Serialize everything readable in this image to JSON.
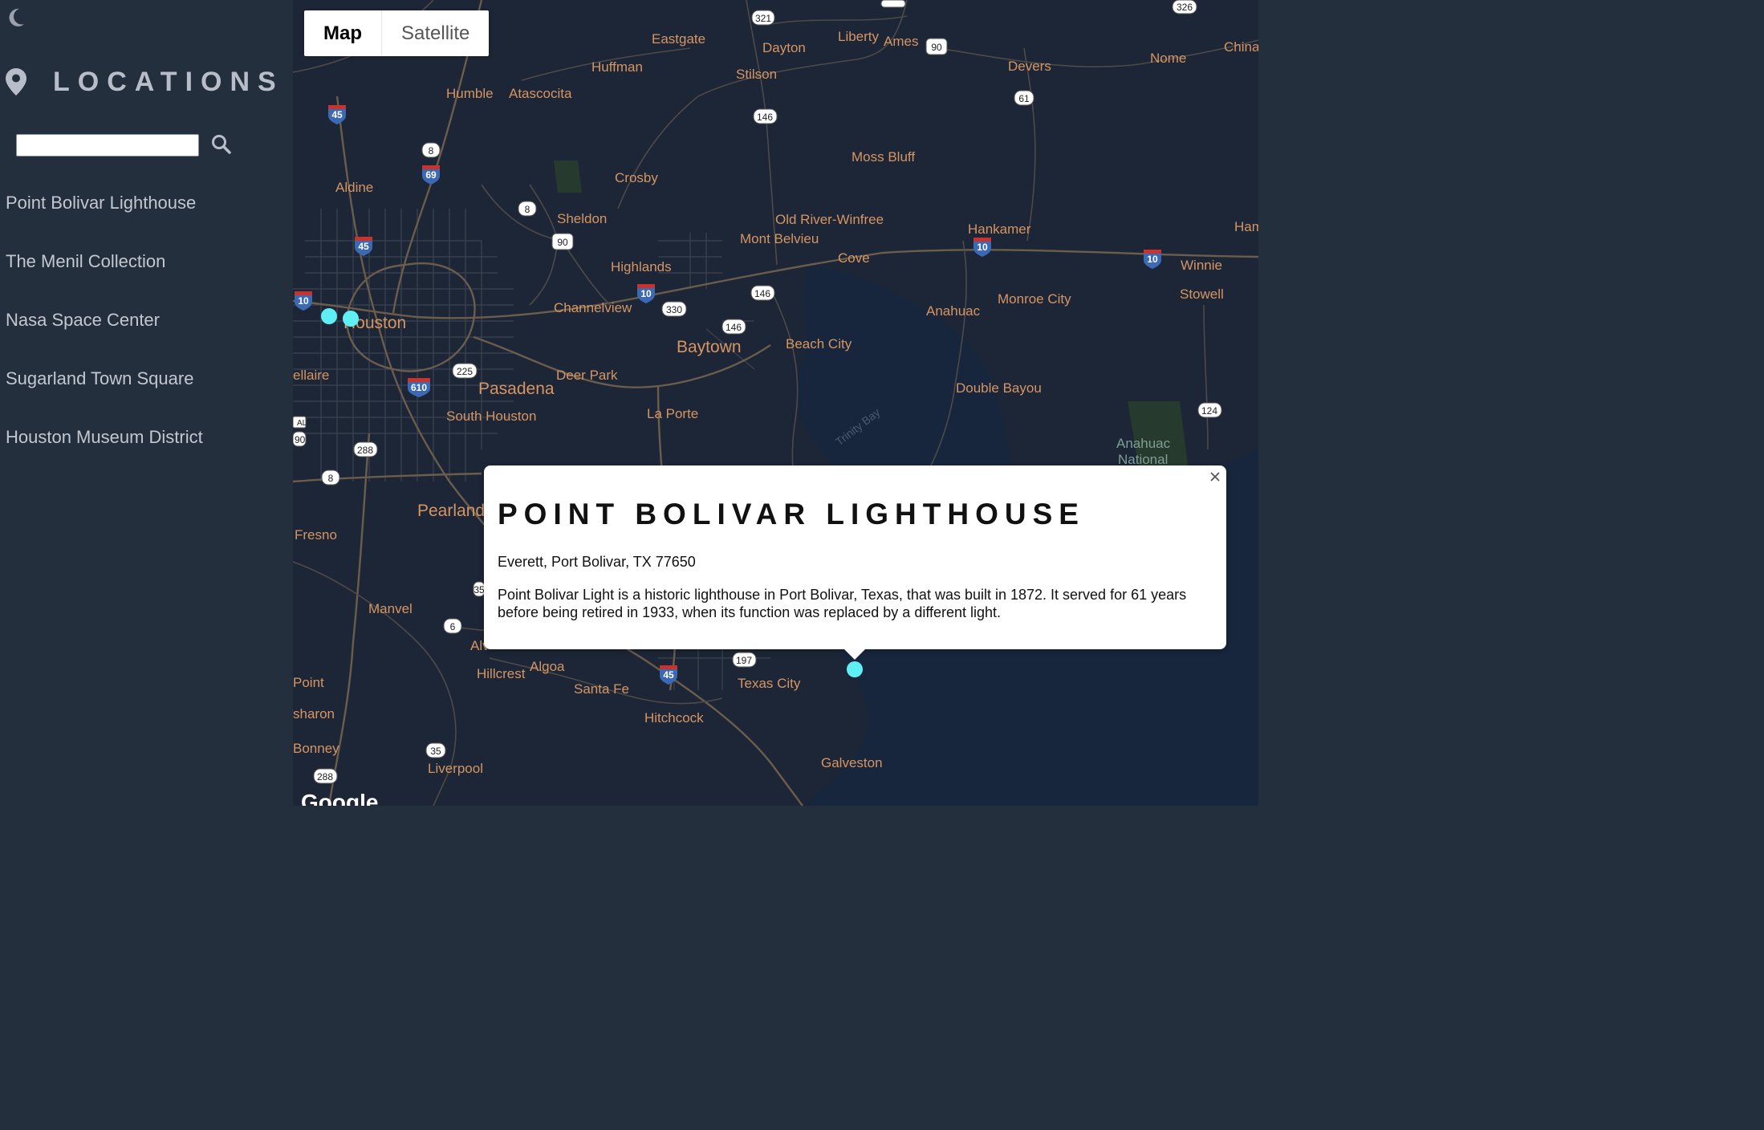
{
  "sidebar": {
    "theme_icon": "moon-icon",
    "header_icon": "map-pin-icon",
    "title": "LOCATIONS",
    "search": {
      "placeholder": "",
      "value": "",
      "button_icon": "search-icon"
    },
    "items": [
      {
        "label": "Point Bolivar Lighthouse"
      },
      {
        "label": "The Menil Collection"
      },
      {
        "label": "Nasa Space Center"
      },
      {
        "label": "Sugarland Town Square"
      },
      {
        "label": "Houston Museum District"
      }
    ]
  },
  "map": {
    "type_control": {
      "map_label": "Map",
      "satellite_label": "Satellite",
      "active": "Map"
    },
    "marker_color": "#5ef0f5",
    "places": [
      "Eastgate",
      "Dayton",
      "Liberty",
      "Ames",
      "Devers",
      "Nome",
      "China",
      "Huffman",
      "Stilson",
      "Humble",
      "Atascocita",
      "Moss Bluff",
      "Crosby",
      "Aldine",
      "Sheldon",
      "Old River-Winfree",
      "Mont Belvieu",
      "Hankamer",
      "Cove",
      "Ham",
      "Winnie",
      "Highlands",
      "Stowell",
      "Monroe City",
      "Channelview",
      "Anahuac",
      "Houston",
      "Baytown",
      "Beach City",
      "ellaire",
      "Deer Park",
      "Pasadena",
      "Double Bayou",
      "South Houston",
      "La Porte",
      "Anahuac",
      "National",
      "Pearland",
      "Fresno",
      "Manvel",
      "Alv",
      "Algoa",
      "Hillcrest",
      "Point",
      "Santa Fe",
      "Texas City",
      "sharon",
      "Hitchcock",
      "Bonney",
      "Galveston",
      "Liverpool"
    ],
    "water_labels": [
      "Trinity Bay"
    ],
    "shields": [
      "321",
      "146",
      "326",
      "90",
      "61",
      "146",
      "8",
      "8",
      "90",
      "146",
      "330",
      "146",
      "225",
      "288",
      "8",
      "6",
      "35",
      "197",
      "124",
      "35",
      "288",
      "ALT",
      "90"
    ],
    "interstates": [
      "45",
      "69",
      "45",
      "10",
      "10",
      "10",
      "10",
      "610",
      "45"
    ],
    "attribution": "Google",
    "info_window": {
      "title": "POINT BOLIVAR LIGHTHOUSE",
      "address": "Everett, Port Bolivar, TX 77650",
      "description": "Point Bolivar Light is a historic lighthouse in Port Bolivar, Texas, that was built in 1872. It served for 61 years before being retired in 1933, when its function was replaced by a different light.",
      "close_icon": "close-icon"
    }
  }
}
